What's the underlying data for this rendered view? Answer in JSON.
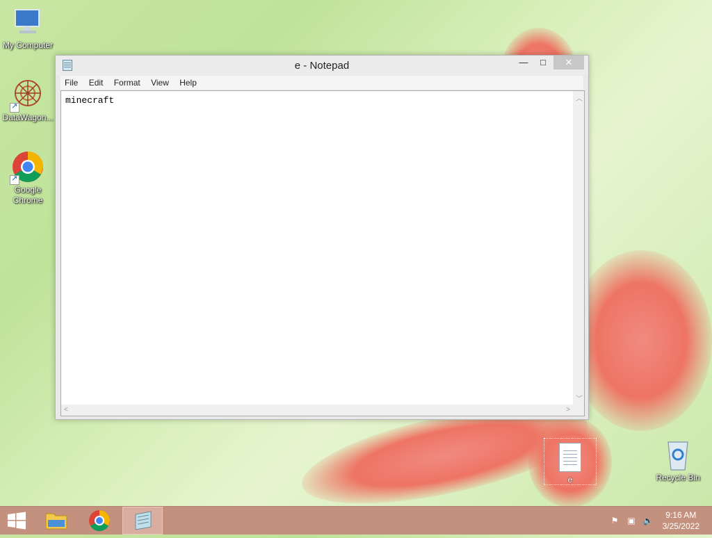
{
  "desktop": {
    "icons": [
      {
        "label": "My Computer",
        "icon": "computer-icon"
      },
      {
        "label": "DataWagon...",
        "icon": "datawagon-icon"
      },
      {
        "label": "Google Chrome",
        "icon": "chrome-icon"
      },
      {
        "label": "Recycle Bin",
        "icon": "recycle-bin-icon"
      },
      {
        "label": "e",
        "icon": "text-file-icon"
      }
    ]
  },
  "notepad": {
    "title": "e - Notepad",
    "controls": {
      "minimize": "—",
      "maximize": "□",
      "close": "✕"
    },
    "menu": [
      "File",
      "Edit",
      "Format",
      "View",
      "Help"
    ],
    "content": "minecraft"
  },
  "taskbar": {
    "items": [
      {
        "name": "start",
        "icon": "windows-logo-icon"
      },
      {
        "name": "file-explorer",
        "icon": "folder-icon"
      },
      {
        "name": "chrome",
        "icon": "chrome-icon"
      },
      {
        "name": "notepad",
        "icon": "notepad-icon",
        "active": true
      }
    ],
    "tray": {
      "time": "9:16 AM",
      "date": "3/25/2022"
    }
  },
  "colors": {
    "taskbar": "#c5917f",
    "desktop_green": "#c7e6a3",
    "flower": "#ee7464"
  }
}
